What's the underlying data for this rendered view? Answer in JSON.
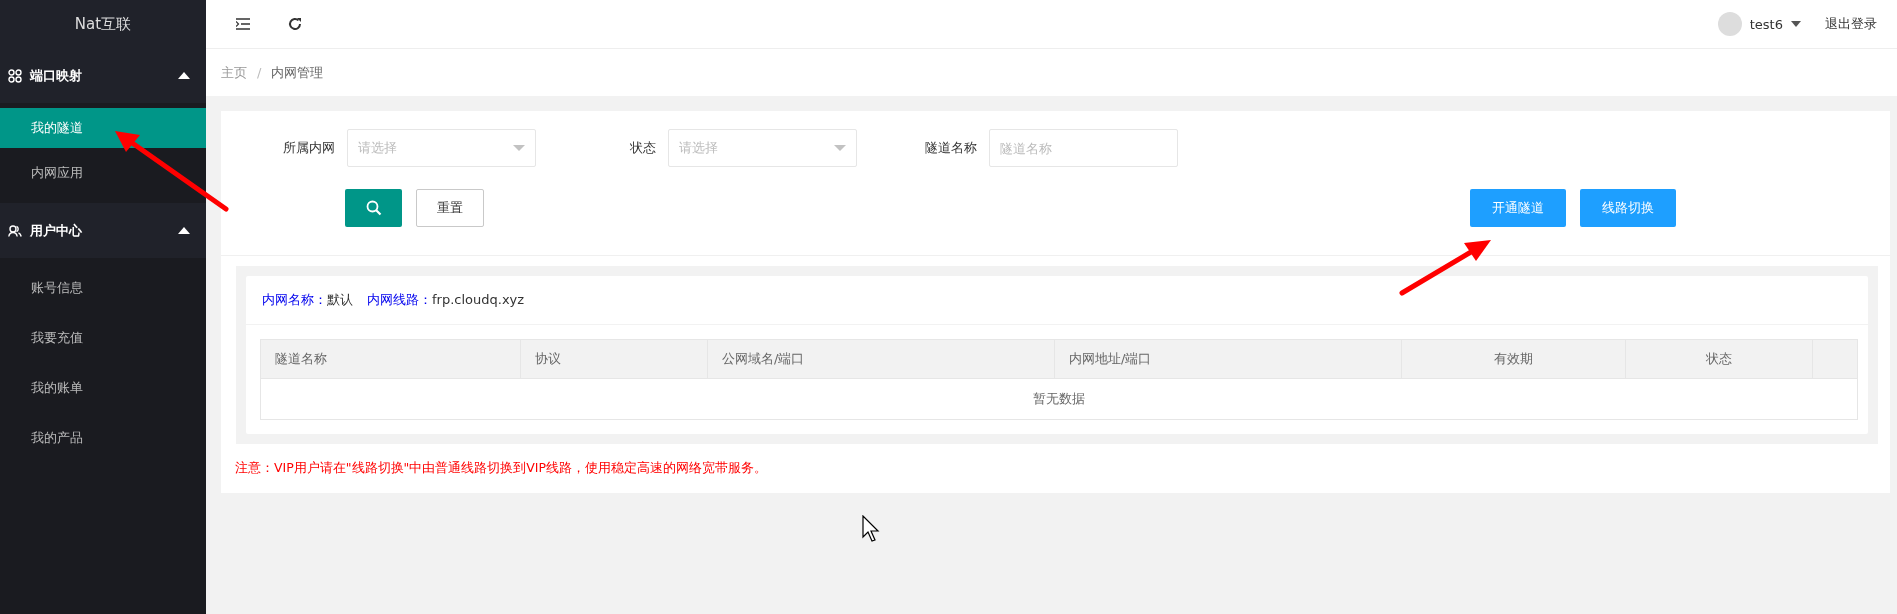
{
  "sidebar": {
    "logo": "Nat互联",
    "groups": [
      {
        "label": "端口映射",
        "kind": "ports",
        "expanded": true,
        "items": [
          {
            "label": "我的隧道",
            "selected": true
          },
          {
            "label": "内网应用",
            "selected": false
          }
        ]
      },
      {
        "label": "用户中心",
        "kind": "users",
        "expanded": true,
        "items": [
          {
            "label": "账号信息",
            "selected": false
          },
          {
            "label": "我要充值",
            "selected": false
          },
          {
            "label": "我的账单",
            "selected": false
          },
          {
            "label": "我的产品",
            "selected": false
          }
        ]
      }
    ]
  },
  "topbar": {
    "username": "test6",
    "logout": "退出登录"
  },
  "breadcrumb": [
    "主页",
    "内网管理"
  ],
  "breadcrumb_separator": "/",
  "filters": [
    {
      "kind": "select",
      "label": "所属内网",
      "placeholder": "请选择"
    },
    {
      "kind": "select",
      "label": "状态",
      "placeholder": "请选择"
    },
    {
      "kind": "input",
      "label": "隧道名称",
      "placeholder": "隧道名称"
    }
  ],
  "reset_button": "重置",
  "action_buttons": [
    "开通隧道",
    "线路切换"
  ],
  "network_info": [
    {
      "label": "内网名称：",
      "value": "默认"
    },
    {
      "label": "内网线路：",
      "value": "frp.cloudq.xyz"
    }
  ],
  "table": {
    "columns": [
      "隧道名称",
      "协议",
      "公网域名/端口",
      "内网地址/端口",
      "有效期",
      "状态"
    ],
    "empty_text": "暂无数据"
  },
  "notice": "注意：VIP用户请在\"线路切换\"中由普通线路切换到VIP线路，使用稳定高速的网络宽带服务。"
}
